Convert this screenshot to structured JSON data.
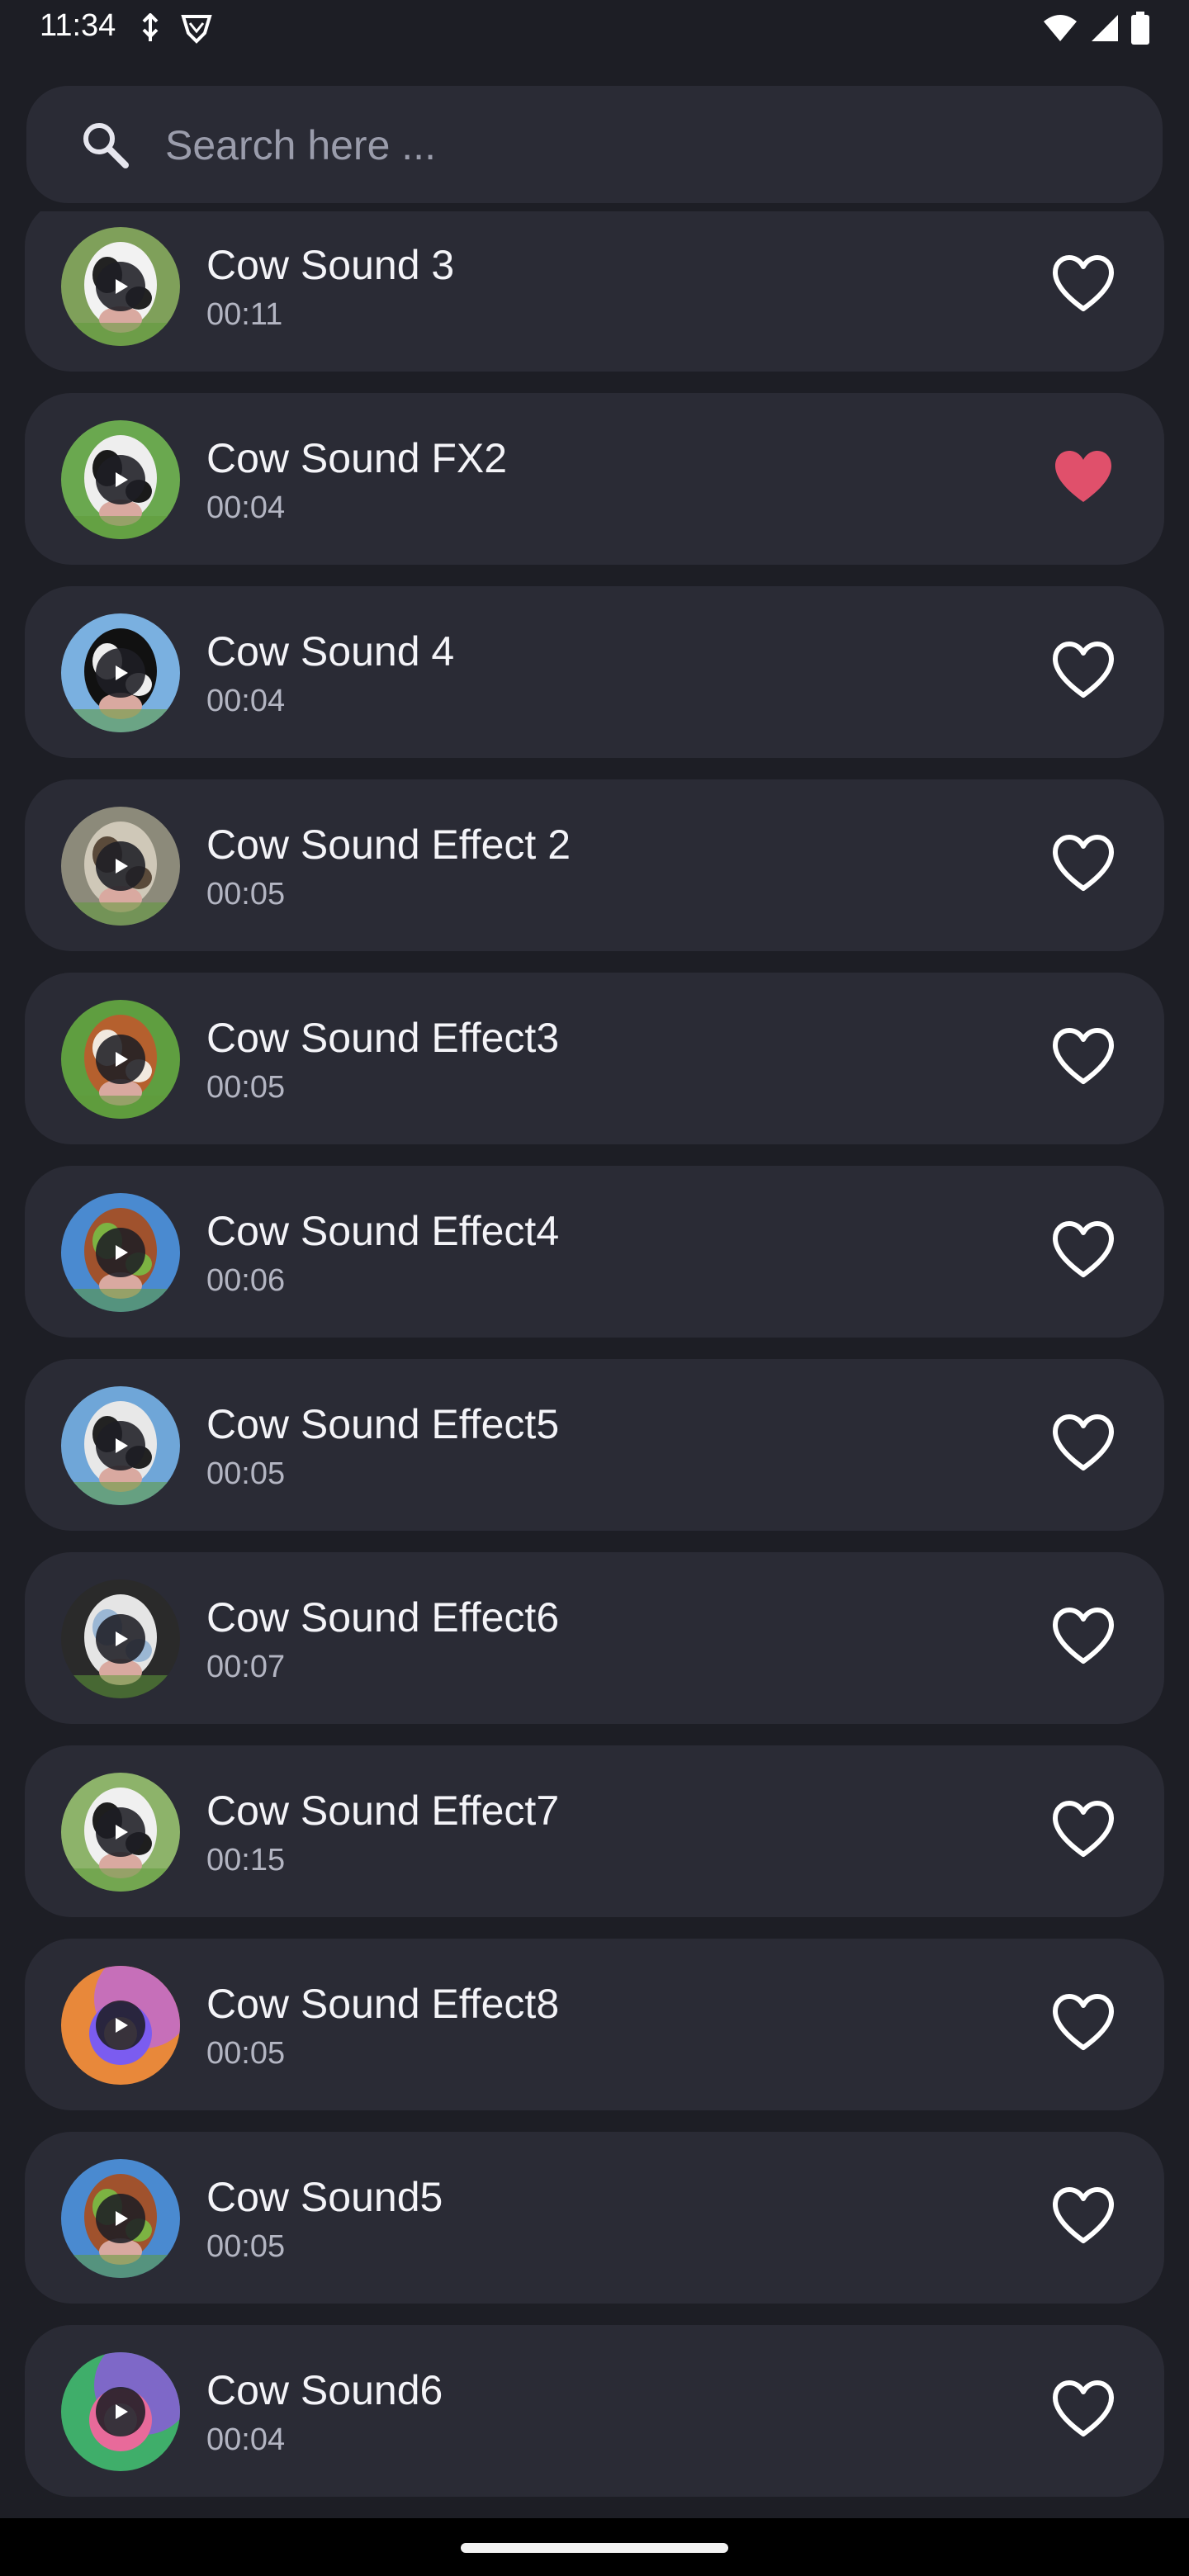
{
  "status_bar": {
    "time": "11:34",
    "left_icons": [
      "usb-debug-icon",
      "shield-icon"
    ],
    "right_icons": [
      "wifi-icon",
      "signal-icon",
      "battery-icon"
    ]
  },
  "search": {
    "placeholder": "Search here ...",
    "value": ""
  },
  "colors": {
    "background": "#1d1e25",
    "card": "#2a2b35",
    "favorite_active": "#e0506b",
    "text_secondary": "#b3b5c2"
  },
  "sounds": [
    {
      "title": "Cow Sound 3",
      "duration": "00:11",
      "favorite": false,
      "thumb": "cow-photo"
    },
    {
      "title": "Cow Sound FX2",
      "duration": "00:04",
      "favorite": true,
      "thumb": "cow-photo"
    },
    {
      "title": "Cow Sound 4",
      "duration": "00:04",
      "favorite": false,
      "thumb": "cow-photo"
    },
    {
      "title": "Cow Sound Effect 2",
      "duration": "00:05",
      "favorite": false,
      "thumb": "cow-photo"
    },
    {
      "title": "Cow Sound Effect3",
      "duration": "00:05",
      "favorite": false,
      "thumb": "cow-photo"
    },
    {
      "title": "Cow Sound Effect4",
      "duration": "00:06",
      "favorite": false,
      "thumb": "cow-photo"
    },
    {
      "title": "Cow Sound Effect5",
      "duration": "00:05",
      "favorite": false,
      "thumb": "cow-photo"
    },
    {
      "title": "Cow Sound Effect6",
      "duration": "00:07",
      "favorite": false,
      "thumb": "cow-photo"
    },
    {
      "title": "Cow Sound Effect7",
      "duration": "00:15",
      "favorite": false,
      "thumb": "cow-photo"
    },
    {
      "title": "Cow Sound Effect8",
      "duration": "00:05",
      "favorite": false,
      "thumb": "abstract-orange"
    },
    {
      "title": "Cow Sound5",
      "duration": "00:05",
      "favorite": false,
      "thumb": "cow-photo"
    },
    {
      "title": "Cow Sound6",
      "duration": "00:04",
      "favorite": false,
      "thumb": "abstract-green"
    }
  ]
}
